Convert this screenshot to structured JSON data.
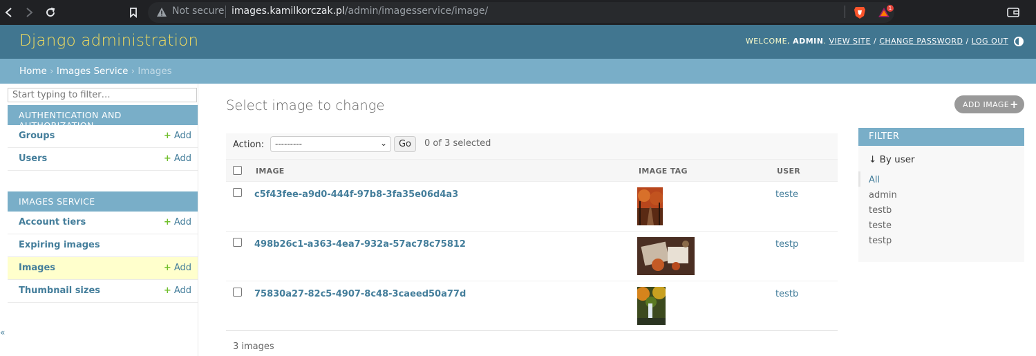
{
  "browser": {
    "not_secure": "Not secure",
    "url_host": "images.kamilkorczak.pl",
    "url_path": "/admin/imagesservice/image/",
    "rewards_badge": "1"
  },
  "header": {
    "branding": "Django administration",
    "welcome": "WELCOME,",
    "user": "ADMIN",
    "view_site": "VIEW SITE",
    "change_password": "CHANGE PASSWORD",
    "log_out": "LOG OUT"
  },
  "breadcrumbs": {
    "home": "Home",
    "app": "Images Service",
    "current": "Images"
  },
  "sidebar": {
    "filter_placeholder": "Start typing to filter…",
    "apps": [
      {
        "caption": "AUTHENTICATION AND AUTHORIZATION",
        "models": [
          {
            "name": "Groups",
            "add": "Add"
          },
          {
            "name": "Users",
            "add": "Add"
          }
        ]
      },
      {
        "caption": "IMAGES SERVICE",
        "models": [
          {
            "name": "Account tiers",
            "add": "Add"
          },
          {
            "name": "Expiring images",
            "add": ""
          },
          {
            "name": "Images",
            "add": "Add"
          },
          {
            "name": "Thumbnail sizes",
            "add": "Add"
          }
        ]
      }
    ],
    "collapse": "«"
  },
  "main": {
    "title": "Select image to change",
    "add_button": "ADD IMAGE",
    "action_label": "Action:",
    "action_value": "---------",
    "go": "Go",
    "selected": "0 of 3 selected",
    "columns": [
      "IMAGE",
      "IMAGE TAG",
      "USER"
    ],
    "rows": [
      {
        "image": "c5f43fee-a9d0-444f-97b8-3fa35e06d4a3",
        "user": "teste"
      },
      {
        "image": "498b26c1-a363-4ea7-932a-57ac78c75812",
        "user": "testp"
      },
      {
        "image": "75830a27-82c5-4907-8c48-3caeed50a77d",
        "user": "testb"
      }
    ],
    "paginator": "3 images"
  },
  "filter": {
    "title": "FILTER",
    "subtitle": "↓ By user",
    "options": [
      "All",
      "admin",
      "testb",
      "teste",
      "testp"
    ],
    "selected": "All"
  },
  "colors": {
    "header": "#417690",
    "branding": "#f5dd5d",
    "breadcrumbs": "#79aec8",
    "link": "#447e9b",
    "add_green": "#70bf2b",
    "active_row": "#ffffcc"
  }
}
